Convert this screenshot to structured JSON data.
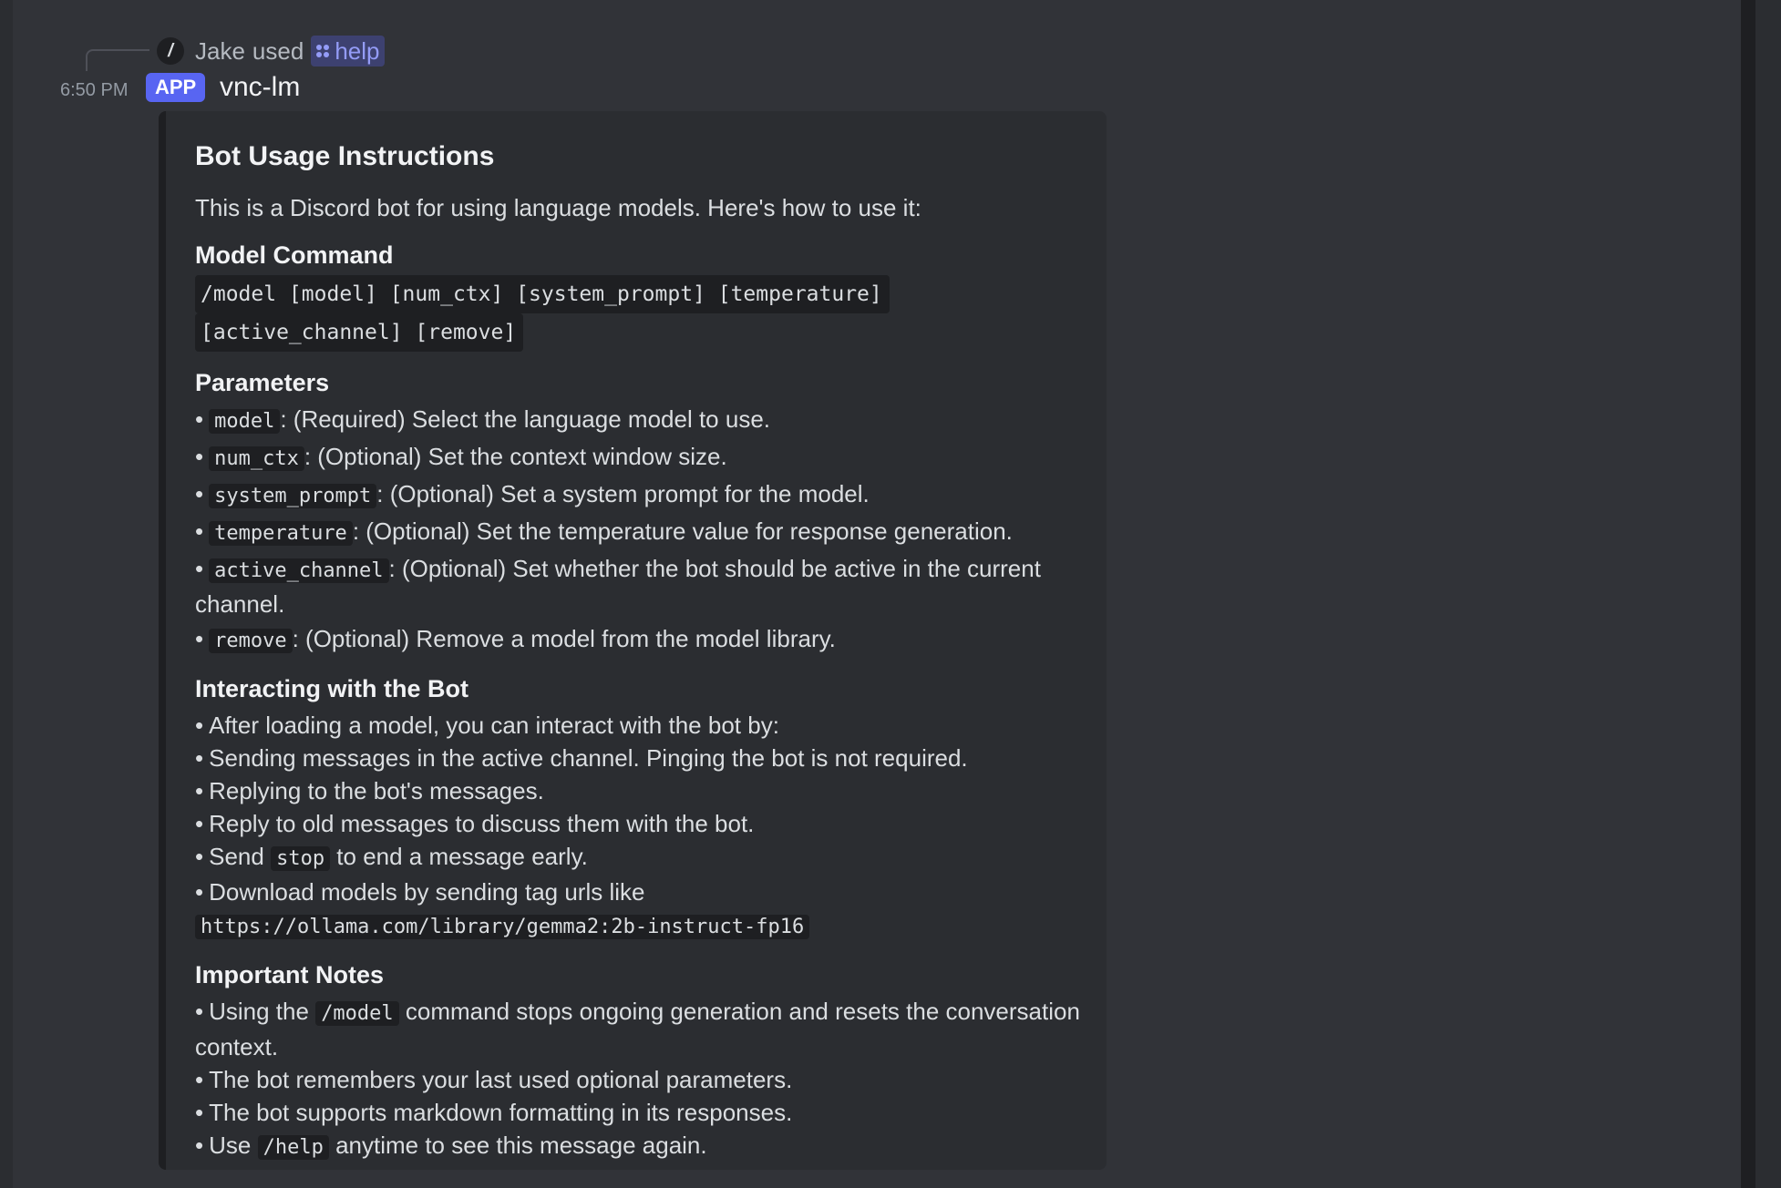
{
  "reply": {
    "user": "Jake",
    "used_text": "used",
    "command": "help"
  },
  "message": {
    "timestamp": "6:50 PM",
    "badge": "APP",
    "username": "vnc-lm"
  },
  "embed": {
    "title": "Bot Usage Instructions",
    "intro": "This is a Discord bot for using language models. Here's how to use it:",
    "model_command": {
      "heading": "Model Command",
      "code_line_1": "/model [model] [num_ctx] [system_prompt] [temperature]",
      "code_line_2": "[active_channel] [remove]"
    },
    "parameters": {
      "heading": "Parameters",
      "items": [
        {
          "code": "model",
          "text": ": (Required) Select the language model to use."
        },
        {
          "code": "num_ctx",
          "text": ": (Optional) Set the context window size."
        },
        {
          "code": "system_prompt",
          "text": ": (Optional) Set a system prompt for the model."
        },
        {
          "code": "temperature",
          "text": ": (Optional) Set the temperature value for response generation."
        },
        {
          "code": "active_channel",
          "text": ": (Optional) Set whether the bot should be active in the current channel."
        },
        {
          "code": "remove",
          "text": ": (Optional) Remove a model from the model library."
        }
      ]
    },
    "interacting": {
      "heading": "Interacting with the Bot",
      "items": [
        "After loading a model, you can interact with the bot by:",
        "Sending messages in the active channel. Pinging the bot is not required.",
        "Replying to the bot's messages.",
        "Reply to old messages to discuss them with the bot."
      ],
      "send_prefix": "Send",
      "send_code": "stop",
      "send_suffix": "to end a message early.",
      "download_text": "Download models by sending tag urls like",
      "download_code": "https://ollama.com/library/gemma2:2b-instruct-fp16"
    },
    "notes": {
      "heading": "Important Notes",
      "note1_prefix": "Using the",
      "note1_code": "/model",
      "note1_suffix": "command stops ongoing generation and resets the conversation context.",
      "items": [
        "The bot remembers your last used optional parameters.",
        "The bot supports markdown formatting in its responses."
      ],
      "last_prefix": "Use",
      "last_code": "/help",
      "last_suffix": "anytime to see this message again."
    }
  },
  "colors": {
    "background": "#313338",
    "embed_background": "#2b2d31",
    "badge": "#5865f2",
    "mention": "#949cf7"
  },
  "icons": {
    "slash": "slash-command-icon",
    "apps": "apps-icon"
  }
}
